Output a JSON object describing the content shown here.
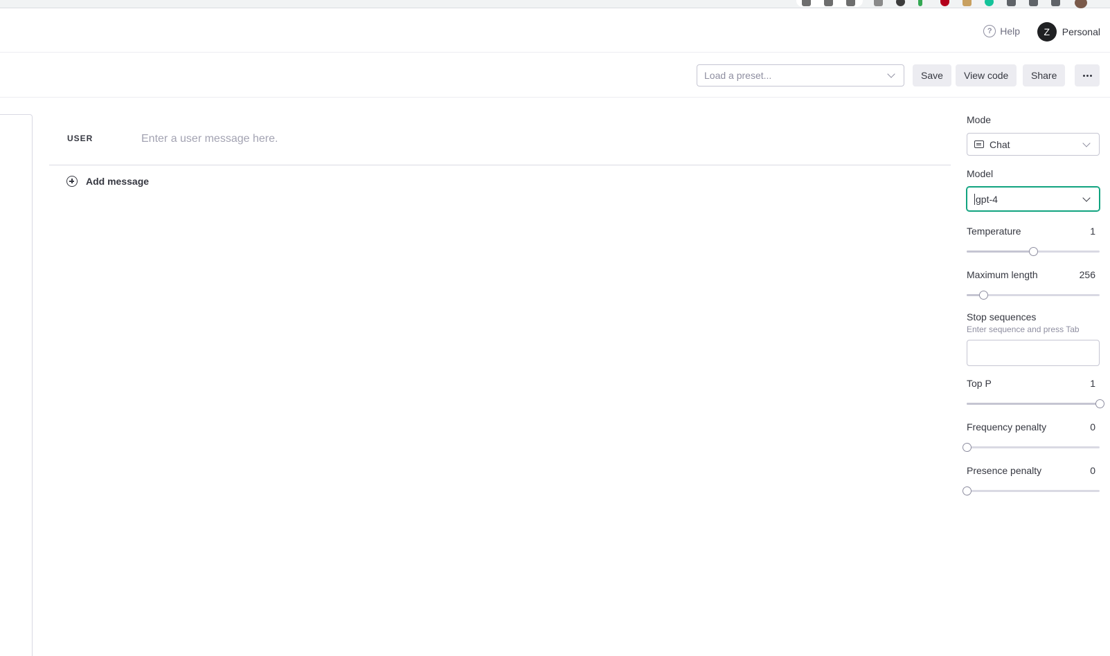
{
  "browser": {
    "extension_icons": [
      {
        "name": "translate-icon",
        "color": "#6e6e6e"
      },
      {
        "name": "share-icon",
        "color": "#6e6e6e"
      },
      {
        "name": "star-icon",
        "color": "#6e6e6e"
      },
      {
        "name": "tab-icon",
        "color": "#8a8a8a"
      },
      {
        "name": "circle-ext-icon",
        "color": "#3c3c3c"
      },
      {
        "name": "leaf-ext-icon",
        "color": "#34a853"
      },
      {
        "name": "heart-ext-icon",
        "color": "#b3001b"
      },
      {
        "name": "doc-ext-icon",
        "color": "#c8a060"
      },
      {
        "name": "grammarly-icon",
        "color": "#15c39a"
      },
      {
        "name": "puzzle-icon",
        "color": "#5f6368"
      },
      {
        "name": "music-ext-icon",
        "color": "#5f6368"
      },
      {
        "name": "window-icon",
        "color": "#5f6368"
      },
      {
        "name": "profile-avatar-icon",
        "color": "#7a5a4a"
      }
    ]
  },
  "topnav": {
    "help_label": "Help",
    "avatar_initial": "Z",
    "org_label": "Personal"
  },
  "toolbar": {
    "preset_placeholder": "Load a preset...",
    "save_label": "Save",
    "view_code_label": "View code",
    "share_label": "Share"
  },
  "chat": {
    "role_label": "USER",
    "message_placeholder": "Enter a user message here.",
    "add_message_label": "Add message"
  },
  "settings": {
    "mode": {
      "label": "Mode",
      "value": "Chat"
    },
    "model": {
      "label": "Model",
      "value": "gpt-4",
      "accent_color": "#10a37f"
    },
    "temperature": {
      "label": "Temperature",
      "value": "1",
      "fraction": 0.5
    },
    "maximum_length": {
      "label": "Maximum length",
      "value": "256",
      "fraction": 0.125
    },
    "stop_sequences": {
      "label": "Stop sequences",
      "hint": "Enter sequence and press Tab"
    },
    "top_p": {
      "label": "Top P",
      "value": "1",
      "fraction": 1.0
    },
    "frequency_penalty": {
      "label": "Frequency penalty",
      "value": "0",
      "fraction": 0.0
    },
    "presence_penalty": {
      "label": "Presence penalty",
      "value": "0",
      "fraction": 0.0
    }
  }
}
